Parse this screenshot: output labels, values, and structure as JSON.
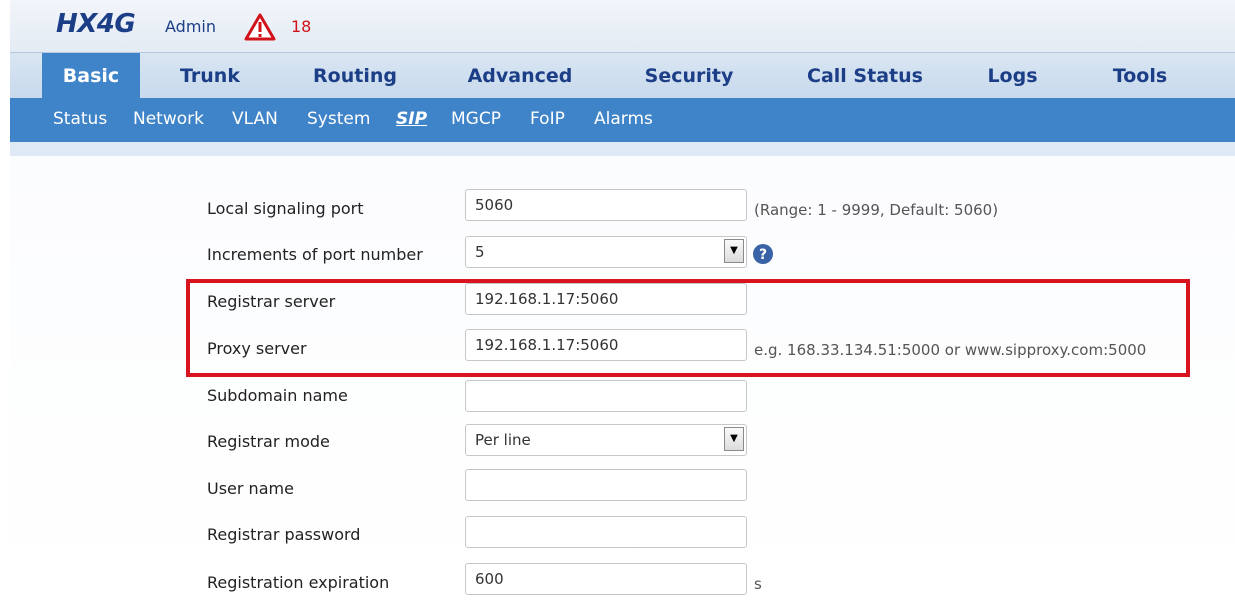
{
  "header": {
    "logo": "HX4G",
    "user": "Admin",
    "alarm_count": "18",
    "alarm_icon": "warning-triangle-icon"
  },
  "main_nav": [
    {
      "label": "Basic",
      "active": true
    },
    {
      "label": "Trunk"
    },
    {
      "label": "Routing"
    },
    {
      "label": "Advanced"
    },
    {
      "label": "Security"
    },
    {
      "label": "Call Status"
    },
    {
      "label": "Logs"
    },
    {
      "label": "Tools"
    }
  ],
  "sub_nav": [
    {
      "label": "Status"
    },
    {
      "label": "Network"
    },
    {
      "label": "VLAN"
    },
    {
      "label": "System"
    },
    {
      "label": "SIP",
      "active": true
    },
    {
      "label": "MGCP"
    },
    {
      "label": "FoIP"
    },
    {
      "label": "Alarms"
    }
  ],
  "form": {
    "local_port": {
      "label": "Local signaling port",
      "value": "5060",
      "hint": "(Range: 1 - 9999, Default: 5060)"
    },
    "port_increment": {
      "label": "Increments of port number",
      "value": "5"
    },
    "registrar_server": {
      "label": "Registrar server",
      "value": "192.168.1.17:5060"
    },
    "proxy_server": {
      "label": "Proxy server",
      "value": "192.168.1.17:5060",
      "hint": "e.g. 168.33.134.51:5000 or www.sipproxy.com:5000"
    },
    "subdomain": {
      "label": "Subdomain name",
      "value": ""
    },
    "registrar_mode": {
      "label": "Registrar mode",
      "value": "Per line"
    },
    "user_name": {
      "label": "User name",
      "value": ""
    },
    "registrar_password": {
      "label": "Registrar password",
      "value": ""
    },
    "registration_expiration": {
      "label": "Registration expiration",
      "value": "600",
      "unit": "s"
    }
  },
  "colors": {
    "accent": "#3f84c8",
    "nav_text": "#1b3e87",
    "highlight_border": "#d8141e",
    "alarm": "#d0121b"
  }
}
